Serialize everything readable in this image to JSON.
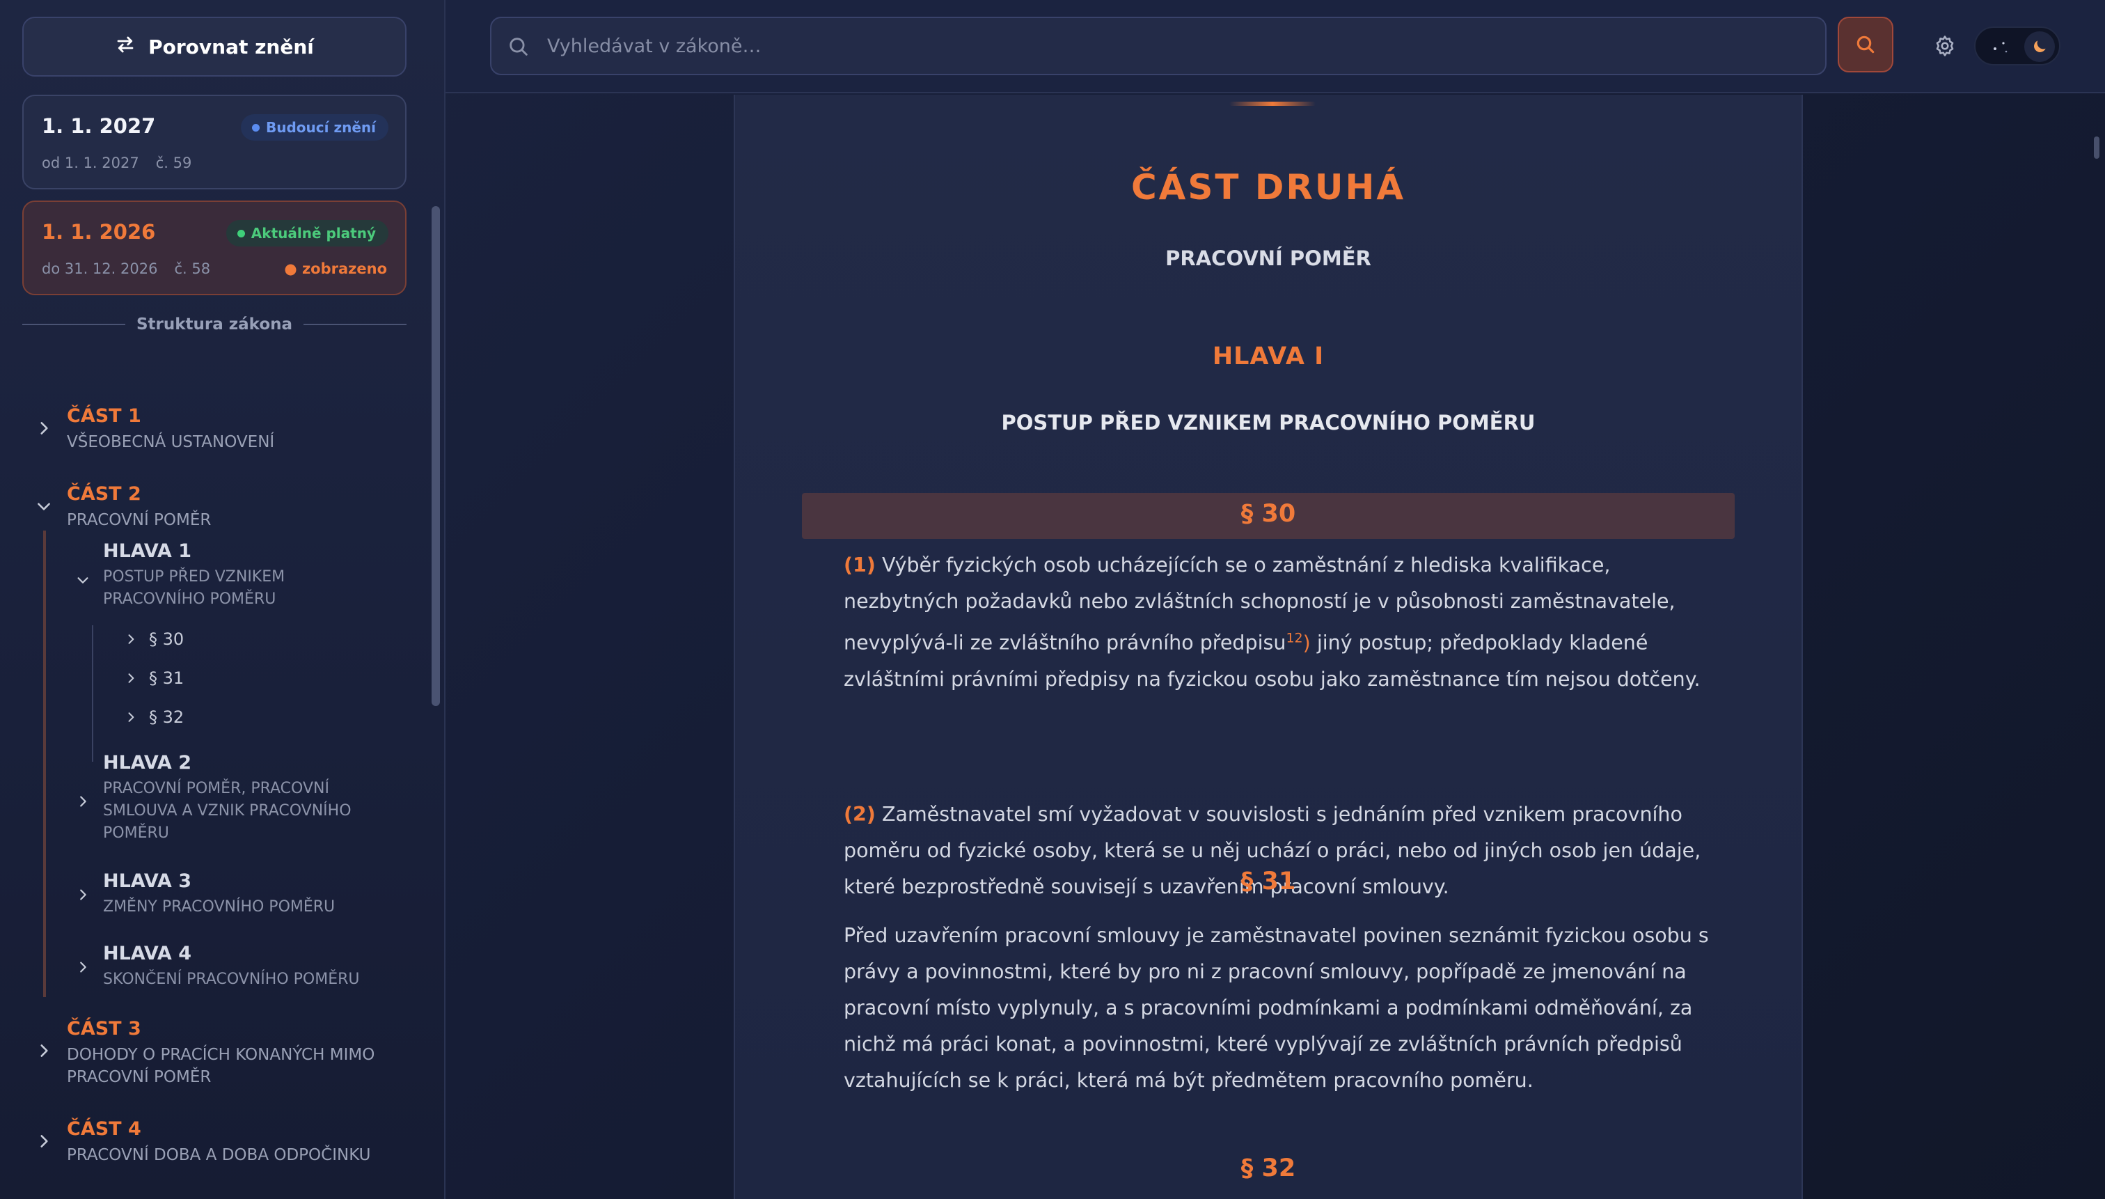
{
  "sidebar": {
    "compare_label": "Porovnat znění",
    "versions": [
      {
        "date": "1. 1. 2027",
        "badge": "Budoucí znění",
        "meta_range": "od 1. 1. 2027",
        "meta_number": "č. 59",
        "shown": ""
      },
      {
        "date": "1. 1. 2026",
        "badge": "Aktuálně platný",
        "meta_range": "do 31. 12. 2026",
        "meta_number": "č. 58",
        "shown": "● zobrazeno"
      }
    ],
    "structure_label": "Struktura zákona",
    "tree": {
      "parts": [
        {
          "title": "ČÁST 1",
          "subtitle": "VŠEOBECNÁ USTANOVENÍ"
        },
        {
          "title": "ČÁST 2",
          "subtitle": "PRACOVNÍ POMĚR"
        },
        {
          "title": "ČÁST 3",
          "subtitle_lines": [
            "DOHODY O PRACÍCH KONANÝCH MIMO",
            "PRACOVNÍ POMĚR"
          ]
        },
        {
          "title": "ČÁST 4",
          "subtitle": "PRACOVNÍ DOBA A DOBA ODPOČINKU"
        }
      ],
      "heads": [
        {
          "title": "HLAVA 1",
          "subtitle_lines": [
            "POSTUP PŘED VZNIKEM",
            "PRACOVNÍHO POMĚRU"
          ]
        },
        {
          "title": "HLAVA 2",
          "subtitle_lines": [
            "PRACOVNÍ POMĚR, PRACOVNÍ",
            "SMLOUVA A VZNIK PRACOVNÍHO",
            "POMĚRU"
          ]
        },
        {
          "title": "HLAVA 3",
          "subtitle": "ZMĚNY PRACOVNÍHO POMĚRU"
        },
        {
          "title": "HLAVA 4",
          "subtitle": "SKONČENÍ PRACOVNÍHO POMĚRU"
        }
      ],
      "sections": [
        "§ 30",
        "§ 31",
        "§ 32"
      ]
    }
  },
  "topbar": {
    "search_placeholder": "Vyhledávat v zákoně…"
  },
  "document": {
    "part_heading": "ČÁST DRUHÁ",
    "part_subtitle": "PRACOVNÍ POMĚR",
    "head_heading": "HLAVA I",
    "head_subtitle": "POSTUP PŘED VZNIKEM PRACOVNÍHO POMĚRU",
    "s30": {
      "title": "§ 30",
      "p1_num": "(1)",
      "p1_a": "Výběr fyzických osob ucházejících se o zaměstnání z hlediska kvalifikace, nezbytných požadavků nebo zvláštních schopností je v působnosti zaměstnavatele, nevyplývá-li ze zvláštního právního předpisu",
      "p1_ref": "12",
      "p1_ref_close": ")",
      "p1_b": " jiný postup; předpoklady kladené zvláštními právními předpisy na fyzickou osobu jako zaměstnance tím nejsou dotčeny.",
      "p2_num": "(2)",
      "p2": "Zaměstnavatel smí vyžadovat v souvislosti s jednáním před vznikem pracovního poměru od fyzické osoby, která se u něj uchází o práci, nebo od jiných osob jen údaje, které bezprostředně souvisejí s uzavřením pracovní smlouvy."
    },
    "s31": {
      "title": "§ 31",
      "text": "Před uzavřením pracovní smlouvy je zaměstnavatel povinen seznámit fyzickou osobu s právy a povinnostmi, které by pro ni z pracovní smlouvy, popřípadě ze jmenování na pracovní místo vyplynuly, a s pracovními podmínkami a podmínkami odměňování, za nichž má práci konat, a povinnostmi, které vyplývají ze zvláštních právních předpisů vztahujících se k práci, která má být předmětem pracovního poměru."
    },
    "s32": {
      "title": "§ 32"
    }
  },
  "colors": {
    "accent": "#f07a3a",
    "future_badge": "#5b8cf0",
    "current_badge": "#3fd07a"
  },
  "icons": [
    "swap-arrows-icon",
    "search-icon",
    "gear-icon",
    "moon-icon",
    "stars-icon",
    "chevron-right-icon",
    "chevron-down-icon"
  ]
}
